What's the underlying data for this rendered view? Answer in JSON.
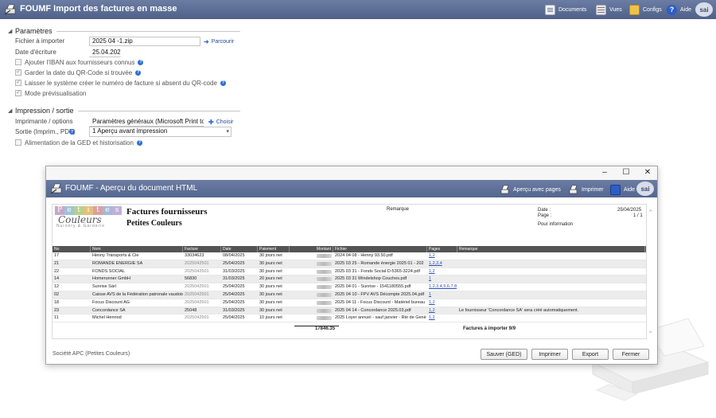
{
  "app": {
    "title": "FOUMF Import des factures en masse",
    "toolbar": [
      {
        "label": "Documents",
        "icon": "documents-icon"
      },
      {
        "label": "Vues",
        "icon": "views-icon"
      },
      {
        "label": "Configs",
        "icon": "configs-icon"
      },
      {
        "label": "Aide",
        "icon": "help-icon"
      }
    ],
    "logo": "sai"
  },
  "params": {
    "section_title": "Paramètres",
    "file_label": "Fichier à importer",
    "file_value": "2025 04 -1.zip",
    "browse_label": "Parcourir",
    "date_label": "Date d'écriture",
    "date_value": "25.04.2025",
    "options": [
      {
        "label": "Ajouter l'IBAN aux fournisseurs connus",
        "checked": false,
        "help": true
      },
      {
        "label": "Garder la date du QR-Code si trouvée",
        "checked": true,
        "help": true
      },
      {
        "label": "Laisser le système créer le numéro de facture si absent du QR-code",
        "checked": true,
        "help": true
      },
      {
        "label": "Mode prévisualisation",
        "checked": true,
        "help": false
      }
    ]
  },
  "output": {
    "section_title": "Impression / sortie",
    "printer_label": "Imprimante / options",
    "printer_value": "Paramètres généraux (Microsoft Print to PDF)",
    "choose_label": "Choisir",
    "output_label": "Sortie (Imprim., PDF)",
    "output_value": "1 Aperçu avant impression",
    "ged_label": "Alimentation de la GED et historisation"
  },
  "preview": {
    "title": "FOUMF - Aperçu du document HTML",
    "actions": [
      {
        "label": "Aperçu avec pages",
        "icon": "preview-pages-icon"
      },
      {
        "label": "Imprimer",
        "icon": "printer-icon"
      },
      {
        "label": "Aide",
        "icon": "help-book-icon"
      }
    ],
    "window_controls": {
      "minimize": "–",
      "maximize": "☐",
      "close": "✕"
    },
    "logo_word": "Petites",
    "logo_script": "Couleurs",
    "logo_tag": "Nursery & Garderie",
    "doc_title": "Factures fournisseurs",
    "doc_subtitle": "Petites Couleurs",
    "remark_header": "Remarque",
    "meta": {
      "date_label": "Date :",
      "date_value": "25/04/2025",
      "page_label": "Page :",
      "page_value": "1 / 1",
      "info": "Pour information"
    },
    "columns": [
      "No",
      "Nom",
      "Facture",
      "Date",
      "Paiement",
      "Montant",
      "Fichier",
      "Pages",
      "Remarque"
    ],
    "rows": [
      {
        "no": "17",
        "nom": "Henny Transports & Cie",
        "facture": "33034623",
        "date": "08/04/2025",
        "paiement": "30 jours net",
        "fichier": "2024 04 08 - Henny 93.50.pdf",
        "pages": "1,2",
        "remarque": "",
        "dim": false
      },
      {
        "no": "21",
        "nom": "ROMANDE ENERGIE SA",
        "facture": "2025042501",
        "date": "25/04/2025",
        "paiement": "30 jours net",
        "fichier": "2025 03 25 - Romande énergie 2025 01 - 202",
        "pages": "1,2,3,4",
        "remarque": "",
        "dim": true
      },
      {
        "no": "22",
        "nom": "FONDS SOCIAL",
        "facture": "2025042501",
        "date": "31/03/2025",
        "paiement": "30 jours net",
        "fichier": "2025 03 31 - Fonds Social D-5365-3224.pdf",
        "pages": "1,2",
        "remarque": "",
        "dim": true
      },
      {
        "no": "14",
        "nom": "Homerunner GmbH",
        "facture": "56830",
        "date": "31/03/2025",
        "paiement": "20 jours net",
        "fichier": "2025 03 31 Windelshop Couches.pdf",
        "pages": "1",
        "remarque": "",
        "dim": false
      },
      {
        "no": "12",
        "nom": "Sunrise Sàrl",
        "facture": "2025042501",
        "date": "25/04/2025",
        "paiement": "30 jours net",
        "fichier": "2025 04 01 - Sunrise - 1541180555.pdf",
        "pages": "1,2,3,4,5,6,7,8",
        "remarque": "",
        "dim": true
      },
      {
        "no": "02",
        "nom": "Caisse AVS de la Fédération patronale vaudoise",
        "facture": "2025042501",
        "date": "25/04/2025",
        "paiement": "30 jours net",
        "fichier": "2025 04 10 - FPV AVS Décompte 2025.04.pdf",
        "pages": "1",
        "remarque": "",
        "dim": true
      },
      {
        "no": "18",
        "nom": "Focus Discount AG",
        "facture": "2025042501",
        "date": "25/04/2025",
        "paiement": "30 jours net",
        "fichier": "2025 04 11 - Focus Discount - Matériel bureau",
        "pages": "1,2",
        "remarque": "",
        "dim": true
      },
      {
        "no": "23",
        "nom": "Concordance SA",
        "facture": "25048",
        "date": "31/03/2025",
        "paiement": "30 jours net",
        "fichier": "2025 04 14 - Concordance 2025.03.pdf",
        "pages": "1,2",
        "remarque": "Le fournisseur 'Concordance SA' sera créé automatiquement.",
        "dim": false
      },
      {
        "no": "11",
        "nom": "Michel Henriod",
        "facture": "2025042501",
        "date": "25/04/2025",
        "paiement": "10 jours net",
        "fichier": "2025 Loyer annuel - sauf janvier - Rte de Genè",
        "pages": "1,2",
        "remarque": "",
        "dim": true
      }
    ],
    "total": "17846.35",
    "summary": "Factures à importer 9/9",
    "company": "Société APC (Petites Couleurs)",
    "buttons": [
      "Sauver (GED)",
      "Imprimer",
      "Export",
      "Fermer"
    ]
  },
  "colors": {
    "titlebar": "#55678f",
    "link": "#2a52be",
    "logo_letters": [
      "#c9a6c9",
      "#9cc4d8",
      "#b7cf8e",
      "#e4c07a",
      "#d9a0a0",
      "#a8b8d8",
      "#c0b0d8"
    ]
  }
}
